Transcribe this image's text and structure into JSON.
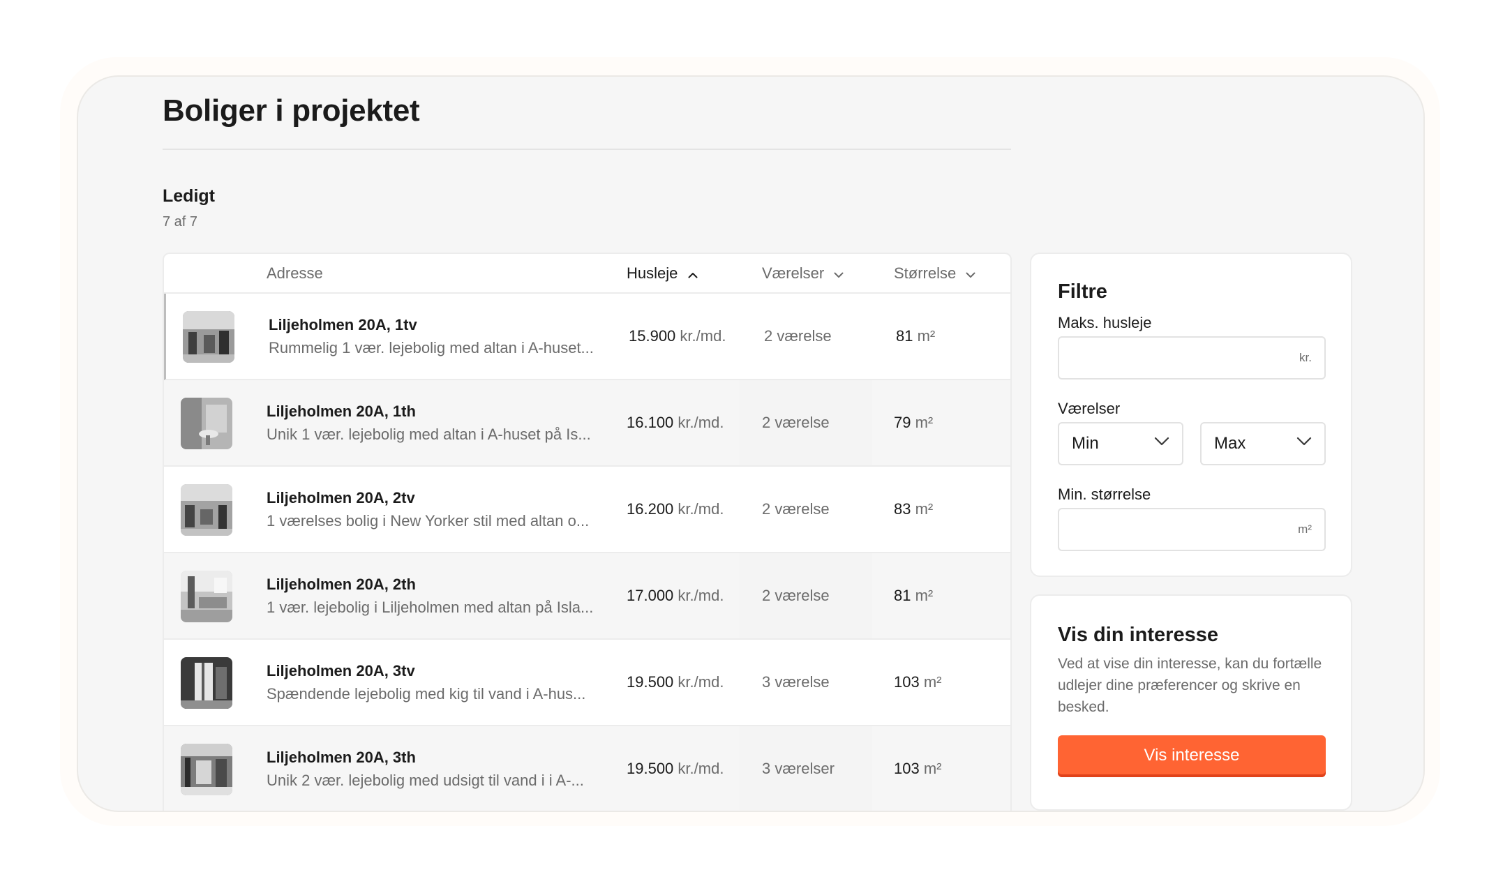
{
  "page": {
    "title": "Boliger i projektet",
    "section": {
      "title": "Ledigt",
      "count": "7 af 7"
    }
  },
  "table": {
    "columns": {
      "address": "Adresse",
      "rent": "Husleje",
      "rooms": "Værelser",
      "size": "Størrelse"
    },
    "sort": {
      "column": "rent",
      "direction": "ascending"
    },
    "rows": [
      {
        "address": "Liljeholmen 20A, 1tv",
        "description": "Rummelig 1 vær. lejebolig med altan i A-huset...",
        "rent": "15.900",
        "rent_unit": "kr./md.",
        "rooms": "2 værelse",
        "size": "81",
        "size_unit": "m²"
      },
      {
        "address": "Liljeholmen 20A, 1th",
        "description": "Unik 1 vær. lejebolig med altan i A-huset på Is...",
        "rent": "16.100",
        "rent_unit": "kr./md.",
        "rooms": "2 værelse",
        "size": "79",
        "size_unit": "m²"
      },
      {
        "address": "Liljeholmen 20A, 2tv",
        "description": "1 værelses bolig i New Yorker stil med altan o...",
        "rent": "16.200",
        "rent_unit": "kr./md.",
        "rooms": "2 værelse",
        "size": "83",
        "size_unit": "m²"
      },
      {
        "address": "Liljeholmen 20A, 2th",
        "description": "1 vær. lejebolig i Liljeholmen med altan på Isla...",
        "rent": "17.000",
        "rent_unit": "kr./md.",
        "rooms": "2 værelse",
        "size": "81",
        "size_unit": "m²"
      },
      {
        "address": "Liljeholmen 20A, 3tv",
        "description": "Spændende lejebolig med kig til vand i A-hus...",
        "rent": "19.500",
        "rent_unit": "kr./md.",
        "rooms": "3 værelse",
        "size": "103",
        "size_unit": "m²"
      },
      {
        "address": "Liljeholmen 20A, 3th",
        "description": "Unik 2 vær. lejebolig med udsigt til vand i i A-...",
        "rent": "19.500",
        "rent_unit": "kr./md.",
        "rooms": "3 værelser",
        "size": "103",
        "size_unit": "m²"
      }
    ]
  },
  "filters": {
    "title": "Filtre",
    "max_rent": {
      "label": "Maks. husleje",
      "value": "",
      "suffix": "kr."
    },
    "rooms": {
      "label": "Værelser",
      "min": "Min",
      "max": "Max"
    },
    "min_size": {
      "label": "Min. størrelse",
      "value": "",
      "suffix": "m²"
    }
  },
  "interest": {
    "title": "Vis din interesse",
    "text": "Ved at vise din interesse, kan du fortælle udlejer dine præferencer og skrive en besked.",
    "button": "Vis interesse"
  },
  "colors": {
    "accent": "#ff6433",
    "text": "#1b1b1b",
    "muted": "#6b6b6b",
    "frame_bg": "#f6f6f6"
  },
  "icons": {
    "sort_asc": "chevron-up-icon",
    "sort_none": "chevron-down-icon",
    "select": "chevron-down-icon"
  }
}
